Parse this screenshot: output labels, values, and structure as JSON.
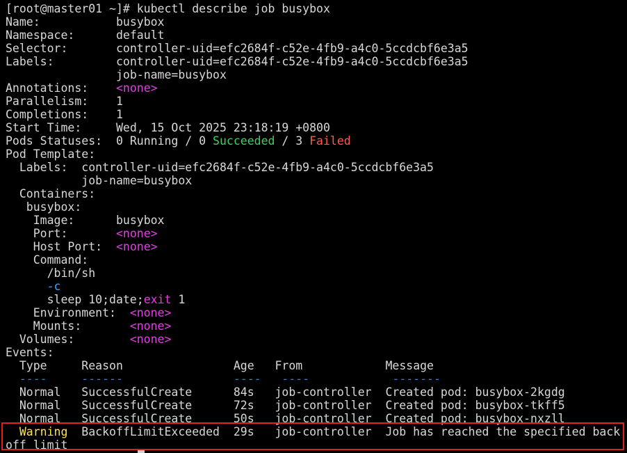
{
  "prompt": "[root@master01 ~]# kubectl describe job busybox",
  "fields": {
    "name_label": "Name:",
    "name_value": "busybox",
    "namespace_label": "Namespace:",
    "namespace_value": "default",
    "selector_label": "Selector:",
    "selector_value": "controller-uid=efc2684f-c52e-4fb9-a4c0-5ccdcbf6e3a5",
    "labels_label": "Labels:",
    "labels_value1": "controller-uid=efc2684f-c52e-4fb9-a4c0-5ccdcbf6e3a5",
    "labels_value2": "job-name=busybox",
    "annotations_label": "Annotations:",
    "annotations_value": "<none>",
    "parallelism_label": "Parallelism:",
    "parallelism_value": "1",
    "completions_label": "Completions:",
    "completions_value": "1",
    "start_time_label": "Start Time:",
    "start_time_value": "Wed, 15 Oct 2025 23:18:19 +0800",
    "pods_statuses_label": "Pods Statuses:",
    "pods_running": "0 Running / 0 ",
    "pods_succeeded": "Succeeded",
    "pods_sep": " / 3 ",
    "pods_failed": "Failed"
  },
  "pod_template": {
    "label": "Pod Template:",
    "labels_label": "  Labels:  ",
    "labels_value1": "controller-uid=efc2684f-c52e-4fb9-a4c0-5ccdcbf6e3a5",
    "labels_value2": "job-name=busybox",
    "containers_label": "  Containers:",
    "container_name": "   busybox:",
    "image_label": "    Image:      ",
    "image_value": "busybox",
    "port_label": "    Port:       ",
    "port_value": "<none>",
    "host_port_label": "    Host Port:  ",
    "host_port_value": "<none>",
    "command_label": "    Command:",
    "cmd1": "      /bin/sh",
    "cmd2": "-c",
    "cmd3_a": "      sleep 10;date;",
    "cmd3_exit": "exit",
    "cmd3_b": " 1",
    "environment_label": "    Environment:  ",
    "environment_value": "<none>",
    "mounts_label": "    Mounts:       ",
    "mounts_value": "<none>",
    "volumes_label": "  Volumes:        ",
    "volumes_value": "<none>"
  },
  "events": {
    "label": "Events:",
    "headers": {
      "type": "Type",
      "reason": "Reason",
      "age": "Age",
      "from": "From",
      "message": "Message"
    },
    "underline": {
      "type": "----",
      "reason": "------",
      "age": "----",
      "from": "----",
      "message": "-------"
    },
    "rows": [
      {
        "type": "Normal",
        "reason": "SuccessfulCreate",
        "age": "84s",
        "from": "job-controller",
        "message": "Created pod: busybox-2kgdg"
      },
      {
        "type": "Normal",
        "reason": "SuccessfulCreate",
        "age": "72s",
        "from": "job-controller",
        "message": "Created pod: busybox-tkff5"
      },
      {
        "type": "Normal",
        "reason": "SuccessfulCreate",
        "age": "50s",
        "from": "job-controller",
        "message": "Created pod: busybox-nxzll"
      },
      {
        "type": "Warning",
        "reason": "BackoffLimitExceeded",
        "age": "29s",
        "from": "job-controller",
        "message": "Job has reached the specified back"
      }
    ],
    "wrap_tail": "off limit"
  },
  "colors": {
    "background": "#000000",
    "text": "#d8d8d8",
    "none": "#e040e0",
    "succeeded": "#3fcf5f",
    "failed": "#ff5a4e",
    "flag": "#3aa6ff",
    "warning": "#ffe34a",
    "highlight_border": "#e02020"
  }
}
